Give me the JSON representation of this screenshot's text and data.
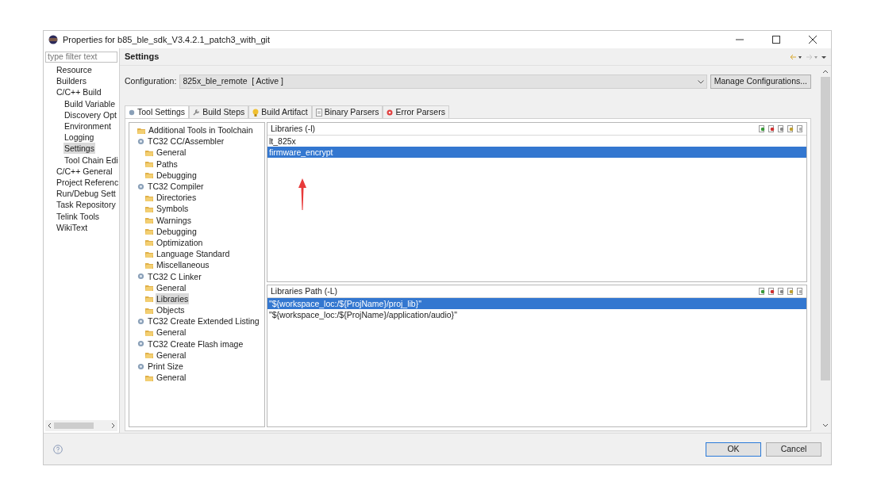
{
  "window": {
    "title": "Properties for b85_ble_sdk_V3.4.2.1_patch3_with_git"
  },
  "sidebar": {
    "filter": {
      "placeholder": "type filter text"
    },
    "items": [
      {
        "label": "Resource",
        "selected": false
      },
      {
        "label": "Builders",
        "selected": false
      },
      {
        "label": "C/C++ Build",
        "selected": false,
        "children": [
          {
            "label": "Build Variable",
            "selected": false
          },
          {
            "label": "Discovery Opt",
            "selected": false
          },
          {
            "label": "Environment",
            "selected": false
          },
          {
            "label": "Logging",
            "selected": false
          },
          {
            "label": "Settings",
            "selected": true
          },
          {
            "label": "Tool Chain Edi",
            "selected": false
          }
        ]
      },
      {
        "label": "C/C++ General",
        "selected": false
      },
      {
        "label": "Project Referenc",
        "selected": false
      },
      {
        "label": "Run/Debug Sett",
        "selected": false
      },
      {
        "label": "Task Repository",
        "selected": false
      },
      {
        "label": "Telink Tools",
        "selected": false
      },
      {
        "label": "WikiText",
        "selected": false
      }
    ]
  },
  "page": {
    "title": "Settings",
    "configuration_label": "Configuration:",
    "configuration_value": "825x_ble_remote  [ Active ]",
    "manage_button": "Manage Configurations..."
  },
  "tabs": [
    {
      "label": "Tool Settings",
      "selected": true,
      "kind": "tool"
    },
    {
      "label": "Build Steps",
      "selected": false,
      "kind": "steps"
    },
    {
      "label": "Build Artifact",
      "selected": false,
      "kind": "artifact"
    },
    {
      "label": "Binary Parsers",
      "selected": false,
      "kind": "binary"
    },
    {
      "label": "Error Parsers",
      "selected": false,
      "kind": "error"
    }
  ],
  "tool_tree": [
    {
      "label": "Additional Tools in Toolchain",
      "kind": "option",
      "selected": false
    },
    {
      "label": "TC32 CC/Assembler",
      "kind": "tool",
      "selected": false,
      "children": [
        {
          "label": "General",
          "kind": "option",
          "selected": false
        },
        {
          "label": "Paths",
          "kind": "option",
          "selected": false
        },
        {
          "label": "Debugging",
          "kind": "option",
          "selected": false
        }
      ]
    },
    {
      "label": "TC32 Compiler",
      "kind": "tool",
      "selected": false,
      "children": [
        {
          "label": "Directories",
          "kind": "option",
          "selected": false
        },
        {
          "label": "Symbols",
          "kind": "option",
          "selected": false
        },
        {
          "label": "Warnings",
          "kind": "option",
          "selected": false
        },
        {
          "label": "Debugging",
          "kind": "option",
          "selected": false
        },
        {
          "label": "Optimization",
          "kind": "option",
          "selected": false
        },
        {
          "label": "Language Standard",
          "kind": "option",
          "selected": false
        },
        {
          "label": "Miscellaneous",
          "kind": "option",
          "selected": false
        }
      ]
    },
    {
      "label": "TC32 C Linker",
      "kind": "tool",
      "selected": false,
      "children": [
        {
          "label": "General",
          "kind": "option",
          "selected": false
        },
        {
          "label": "Libraries",
          "kind": "option",
          "selected": true
        },
        {
          "label": "Objects",
          "kind": "option",
          "selected": false
        }
      ]
    },
    {
      "label": "TC32 Create Extended Listing",
      "kind": "tool",
      "selected": false,
      "children": [
        {
          "label": "General",
          "kind": "option",
          "selected": false
        }
      ]
    },
    {
      "label": "TC32 Create Flash image",
      "kind": "tool",
      "selected": false,
      "children": [
        {
          "label": "General",
          "kind": "option",
          "selected": false
        }
      ]
    },
    {
      "label": "Print Size",
      "kind": "tool",
      "selected": false,
      "children": [
        {
          "label": "General",
          "kind": "option",
          "selected": false
        }
      ]
    }
  ],
  "libraries": {
    "title": "Libraries (-l)",
    "items": [
      {
        "text": "lt_825x",
        "selected": false
      },
      {
        "text": "firmware_encrypt",
        "selected": true
      }
    ]
  },
  "library_paths": {
    "title": "Libraries Path (-L)",
    "items": [
      {
        "text": "\"${workspace_loc:/${ProjName}/proj_lib}\"",
        "selected": true
      },
      {
        "text": "\"${workspace_loc:/${ProjName}/application/audio}\"",
        "selected": false
      }
    ]
  },
  "buttons": {
    "ok": "OK",
    "cancel": "Cancel"
  }
}
